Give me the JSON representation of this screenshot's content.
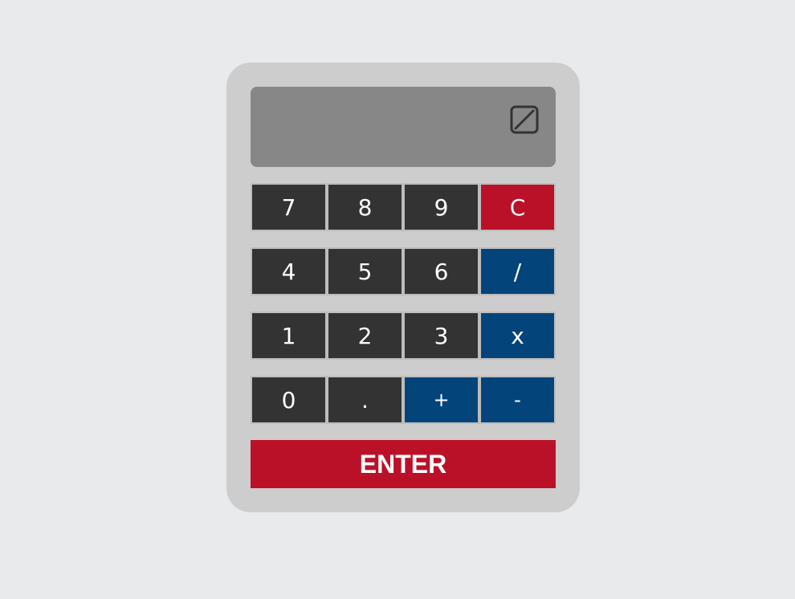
{
  "calculator": {
    "display": {
      "value": "",
      "icon": "display-clear-icon"
    },
    "keys": [
      [
        {
          "label": "7",
          "name": "key-7",
          "color": "#333333"
        },
        {
          "label": "8",
          "name": "key-8",
          "color": "#333333"
        },
        {
          "label": "9",
          "name": "key-9",
          "color": "#333333"
        },
        {
          "label": "C",
          "name": "key-clear",
          "color": "#bb1128"
        }
      ],
      [
        {
          "label": "4",
          "name": "key-4",
          "color": "#333333"
        },
        {
          "label": "5",
          "name": "key-5",
          "color": "#333333"
        },
        {
          "label": "6",
          "name": "key-6",
          "color": "#333333"
        },
        {
          "label": "/",
          "name": "key-divide",
          "color": "#03457a"
        }
      ],
      [
        {
          "label": "1",
          "name": "key-1",
          "color": "#333333"
        },
        {
          "label": "2",
          "name": "key-2",
          "color": "#333333"
        },
        {
          "label": "3",
          "name": "key-3",
          "color": "#333333"
        },
        {
          "label": "x",
          "name": "key-multiply",
          "color": "#03457a"
        }
      ],
      [
        {
          "label": "0",
          "name": "key-0",
          "color": "#333333"
        },
        {
          "label": ".",
          "name": "key-decimal",
          "color": "#333333"
        },
        {
          "label": "+",
          "name": "key-plus",
          "color": "#03457a"
        },
        {
          "label": "-",
          "name": "key-minus",
          "color": "#03457a"
        }
      ]
    ],
    "enter_label": "ENTER",
    "colors": {
      "number_key": "#333333",
      "operator_key": "#03457a",
      "action_key": "#bb1128",
      "display_background": "#878787",
      "body": "#cdcdcd",
      "page_background": "#e9eaec"
    }
  }
}
